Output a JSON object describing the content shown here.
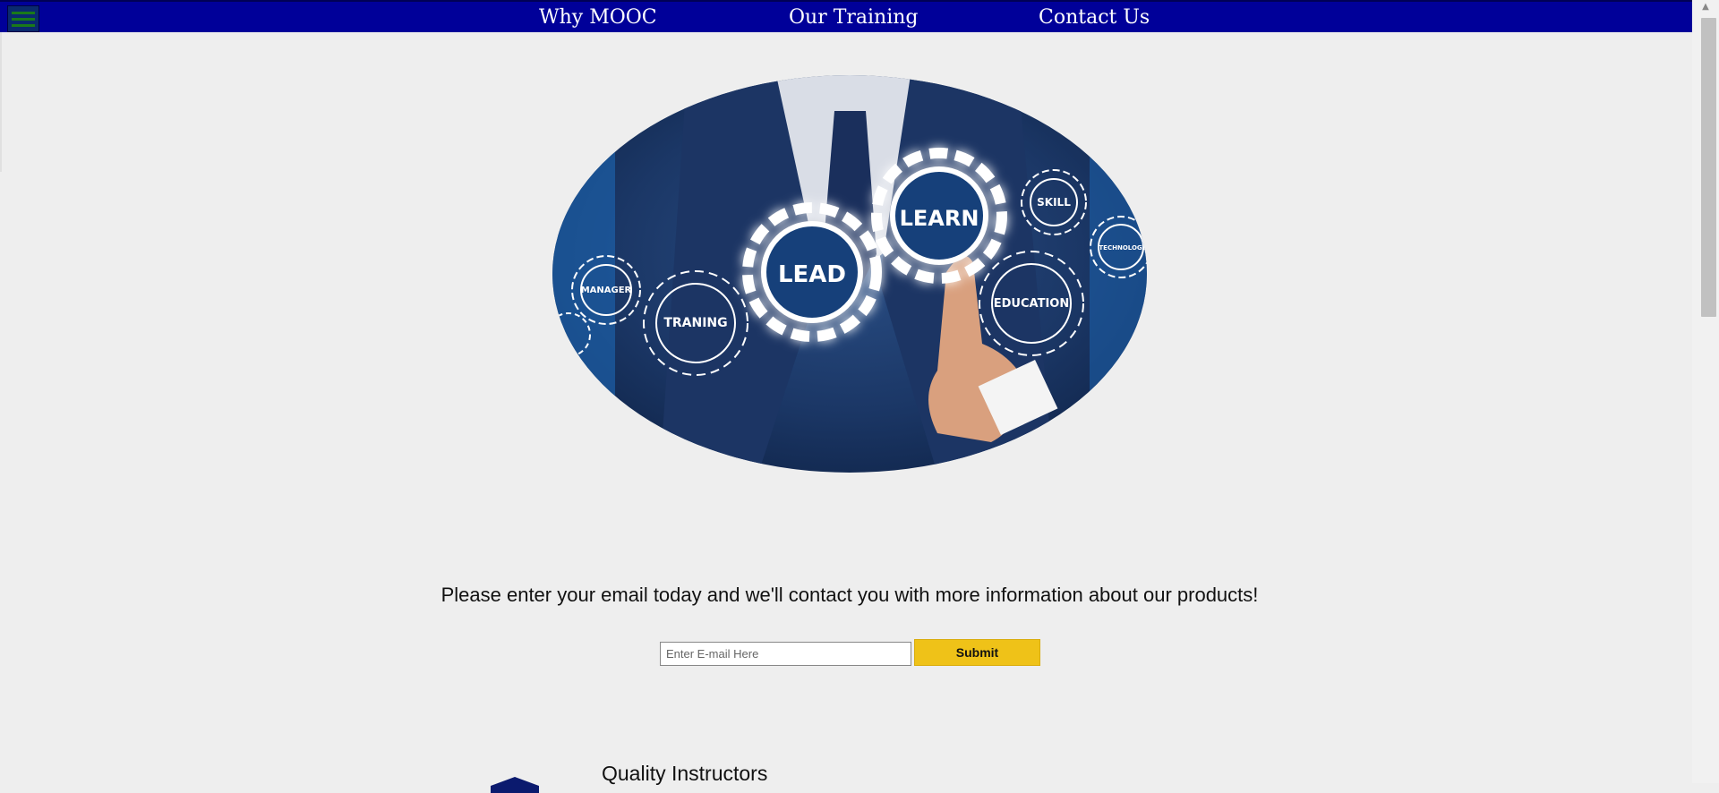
{
  "nav": {
    "links": [
      "Why MOOC",
      "Our Training",
      "Contact Us"
    ]
  },
  "hero": {
    "gears": [
      "LEAD",
      "LEARN",
      "SKILL",
      "TECHNOLOGY",
      "MANAGER",
      "TRANING",
      "EDUCATION"
    ]
  },
  "signup": {
    "prompt": "Please enter your email today and we'll contact you with more information about our products!",
    "email_placeholder": "Enter E-mail Here",
    "submit_label": "Submit"
  },
  "features": {
    "first_title": "Quality Instructors"
  },
  "colors": {
    "nav_bg": "#000099",
    "submit_bg": "#efc218",
    "page_bg": "#eeeeee"
  }
}
